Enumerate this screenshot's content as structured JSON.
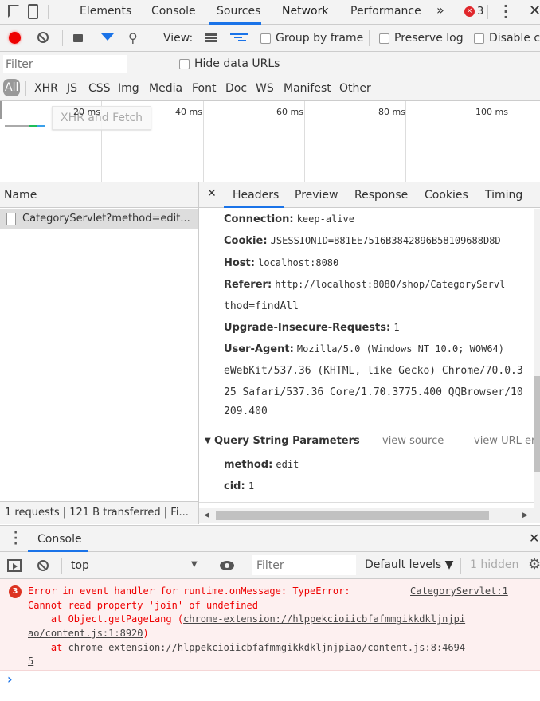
{
  "main_tabs": [
    "Elements",
    "Console",
    "Sources",
    "Network",
    "Performance"
  ],
  "more_tabs": "»",
  "error_count": "3",
  "toolbar": {
    "view_label": "View:",
    "group_by_frame": "Group by frame",
    "preserve_log": "Preserve log",
    "disable_cache": "Disable ca"
  },
  "filter": {
    "placeholder": "Filter",
    "hide_data_urls": "Hide data URLs"
  },
  "types": [
    "All",
    "XHR",
    "JS",
    "CSS",
    "Img",
    "Media",
    "Font",
    "Doc",
    "WS",
    "Manifest",
    "Other"
  ],
  "tooltip": "XHR and Fetch",
  "timeline_ticks": [
    "20 ms",
    "40 ms",
    "60 ms",
    "80 ms",
    "100 ms"
  ],
  "request_list": {
    "header": "Name",
    "rows": [
      "CategoryServlet?method=edit..."
    ],
    "status": "1 requests | 121 B transferred | Fi..."
  },
  "detail_tabs": [
    "Headers",
    "Preview",
    "Response",
    "Cookies",
    "Timing"
  ],
  "headers": [
    {
      "name": "Connection:",
      "value": "keep-alive"
    },
    {
      "name": "Cookie:",
      "value": "JSESSIONID=B81EE7516B3842896B58109688D8D"
    },
    {
      "name": "Host:",
      "value": "localhost:8080"
    },
    {
      "name": "Referer:",
      "value": "http://localhost:8080/shop/CategoryServl",
      "cont": [
        "thod=findAll"
      ]
    },
    {
      "name": "Upgrade-Insecure-Requests:",
      "value": "1"
    },
    {
      "name": "User-Agent:",
      "value": "Mozilla/5.0 (Windows NT 10.0; WOW64)",
      "cont": [
        "eWebKit/537.36 (KHTML, like Gecko) Chrome/70.0.3",
        "25 Safari/537.36 Core/1.70.3775.400 QQBrowser/10",
        "209.400"
      ]
    }
  ],
  "query": {
    "title": "Query String Parameters",
    "view_source": "view source",
    "view_url": "view URL en",
    "params": [
      {
        "name": "method:",
        "value": "edit"
      },
      {
        "name": "cid:",
        "value": "1"
      }
    ]
  },
  "drawer": {
    "tab": "Console",
    "context": "top",
    "filter_placeholder": "Filter",
    "levels": "Default levels ▼",
    "hidden": "1 hidden"
  },
  "console_error": {
    "count": "3",
    "line1": "Error in event handler for runtime.onMessage: TypeError:",
    "source": "CategoryServlet:1",
    "line2": "Cannot read property 'join' of undefined",
    "line3_pre": "    at Object.getPageLang (",
    "line3_link": "chrome-extension://hlppekcioiicbfafmmgikkdkljnjpi",
    "line4_link": "ao/content.js:1:8920",
    "line4_post": ")",
    "line5_pre": "    at ",
    "line5_link": "chrome-extension://hlppekcioiicbfafmmgikkdkljnjpiao/content.js:8:4694",
    "line6_link": "5"
  },
  "prompt": "›"
}
